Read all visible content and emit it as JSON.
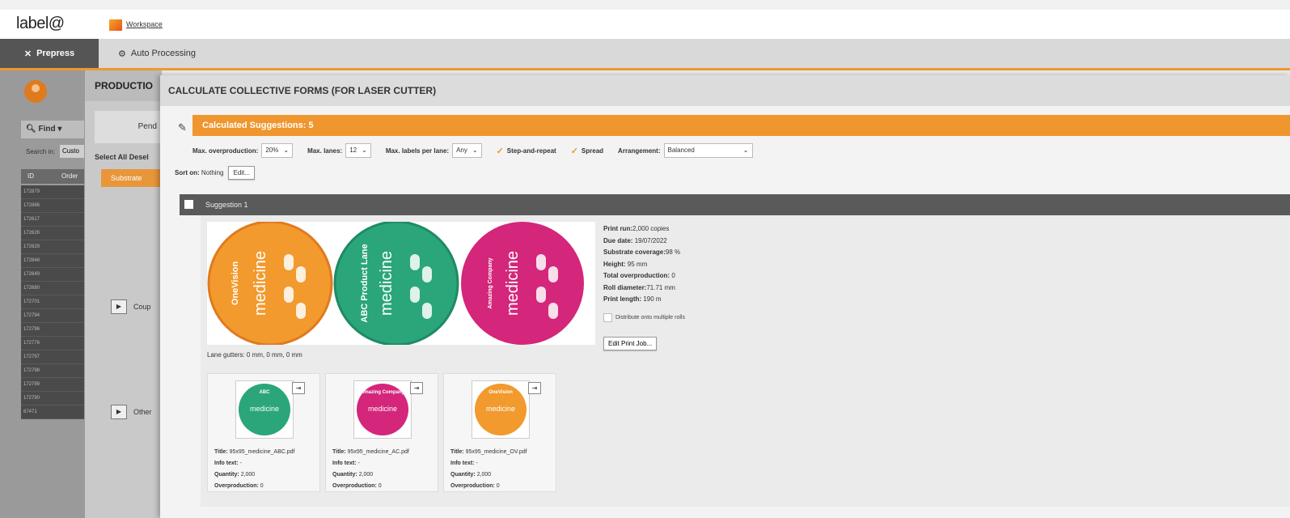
{
  "app": {
    "logo": "label@",
    "workspace_link": "Workspace"
  },
  "nav": {
    "prepress": "Prepress",
    "auto_processing": "Auto Processing"
  },
  "left_panel": {
    "find": "Find",
    "search_in_label": "Search in:",
    "search_value": "Custo",
    "columns": [
      "ID",
      "Order"
    ],
    "rows": [
      "172879",
      "172886",
      "172617",
      "172626",
      "172629",
      "172848",
      "172649",
      "172680",
      "172701",
      "172794",
      "172796",
      "172776",
      "172797",
      "172798",
      "172799",
      "172790",
      "67471"
    ]
  },
  "mid_panel": {
    "heading": "PRODUCTIO",
    "pending": "Pend",
    "select_all": "Select All",
    "deselect": "Desel",
    "substrate_tab": "Substrate",
    "coupon": "Coup",
    "other": "Other"
  },
  "dialog": {
    "title": "CALCULATE COLLECTIVE FORMS (FOR LASER CUTTER)",
    "suggestions_bar": "Calculated Suggestions: 5",
    "options": {
      "max_overproduction_label": "Max. overproduction:",
      "max_overproduction_value": "20%",
      "max_lanes_label": "Max. lanes:",
      "max_lanes_value": "12",
      "max_labels_per_lane_label": "Max. labels per lane:",
      "max_labels_per_lane_value": "Any",
      "step_and_repeat": "Step-and-repeat",
      "spread": "Spread",
      "arrangement_label": "Arrangement:",
      "arrangement_value": "Balanced"
    },
    "sort_label": "Sort on:",
    "sort_value": "Nothing",
    "edit_button": "Edit...",
    "suggestion": {
      "title": "Suggestion 1",
      "preview_labels": [
        {
          "brand": "OneVision",
          "text": "medicine",
          "color": "#f29a2e"
        },
        {
          "brand": "ABC Product Lane",
          "text": "medicine",
          "color": "#2aa67a"
        },
        {
          "brand": "Amazing Company",
          "text": "medicine",
          "color": "#d4267a"
        }
      ],
      "lane_gutters": "Lane gutters: 0 mm, 0 mm, 0 mm",
      "details": {
        "print_run": {
          "label": "Print run:",
          "value": "2,000 copies"
        },
        "due_date": {
          "label": "Due date:",
          "value": "19/07/2022"
        },
        "substrate_coverage": {
          "label": "Substrate coverage:",
          "value": "98 %"
        },
        "height": {
          "label": "Height:",
          "value": "95 mm"
        },
        "total_overproduction": {
          "label": "Total overproduction:",
          "value": "0"
        },
        "roll_diameter": {
          "label": "Roll diameter:",
          "value": "71.71 mm"
        },
        "print_length": {
          "label": "Print length:",
          "value": "190 m"
        }
      },
      "distribute": "Distribute onto multiple rolls",
      "edit_print_job": "Edit Print Job...",
      "jobs": [
        {
          "title_label": "Title:",
          "title": "95x95_medicine_ABC.pdf",
          "info_label": "Info text:",
          "info": "-",
          "qty_label": "Quantity:",
          "qty": "2,000",
          "over_label": "Overproduction:",
          "over": "0",
          "brand": "ABC",
          "thumb_text": "medicine",
          "color": "#2aa67a"
        },
        {
          "title_label": "Title:",
          "title": "95x95_medicine_AC.pdf",
          "info_label": "Info text:",
          "info": "-",
          "qty_label": "Quantity:",
          "qty": "2,000",
          "over_label": "Overproduction:",
          "over": "0",
          "brand": "Amazing Company",
          "thumb_text": "medicine",
          "color": "#d4267a"
        },
        {
          "title_label": "Title:",
          "title": "95x95_medicine_OV.pdf",
          "info_label": "Info text:",
          "info": "-",
          "qty_label": "Quantity:",
          "qty": "2,000",
          "over_label": "Overproduction:",
          "over": "0",
          "brand": "OneVision",
          "thumb_text": "medicine",
          "color": "#f29a2e"
        }
      ]
    }
  }
}
